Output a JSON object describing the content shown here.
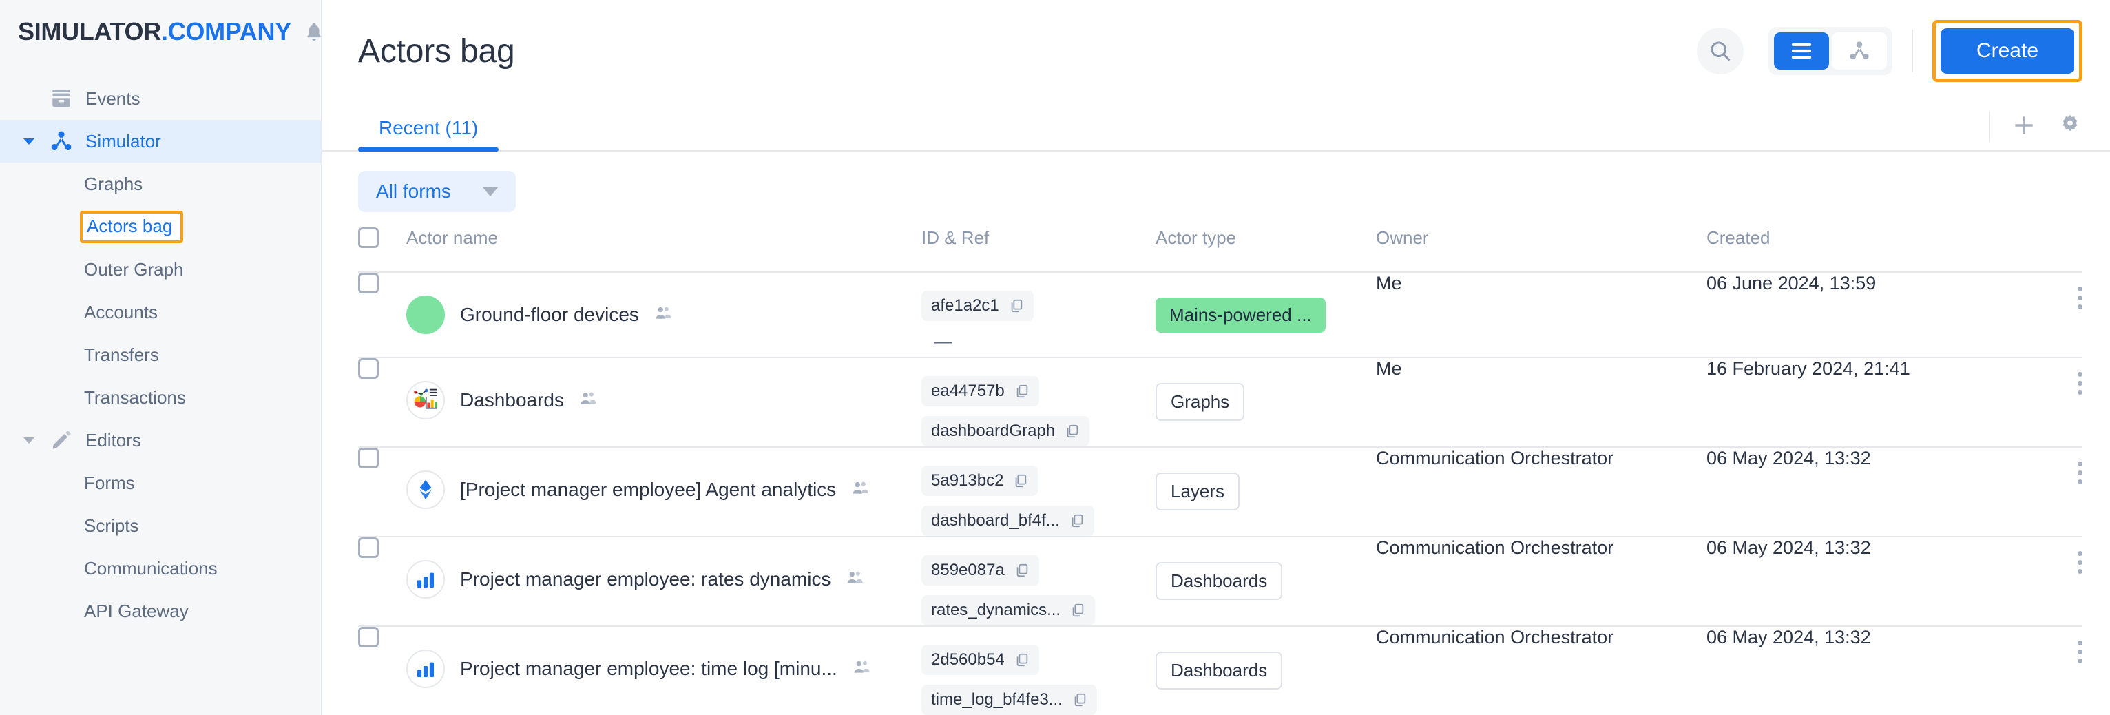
{
  "brand": {
    "name_dark": "SIMULATOR",
    "name_blue": ".COMPANY",
    "bell_icon": "bell-icon"
  },
  "sidebar": {
    "items": [
      {
        "label": "Events",
        "icon": "archive-icon",
        "type": "group",
        "expandable": false,
        "active": false
      },
      {
        "label": "Simulator",
        "icon": "graph-node-icon",
        "type": "group",
        "expandable": true,
        "active": true
      },
      {
        "label": "Graphs",
        "type": "sub",
        "active": false
      },
      {
        "label": "Actors bag",
        "type": "sub",
        "active": true,
        "highlighted": true
      },
      {
        "label": "Outer Graph",
        "type": "sub",
        "active": false
      },
      {
        "label": "Accounts",
        "type": "sub",
        "active": false
      },
      {
        "label": "Transfers",
        "type": "sub",
        "active": false
      },
      {
        "label": "Transactions",
        "type": "sub",
        "active": false
      },
      {
        "label": "Editors",
        "icon": "pencil-icon",
        "type": "group",
        "expandable": true,
        "active": false
      },
      {
        "label": "Forms",
        "type": "sub",
        "active": false
      },
      {
        "label": "Scripts",
        "type": "sub",
        "active": false
      },
      {
        "label": "Communications",
        "type": "sub",
        "active": false
      },
      {
        "label": "API Gateway",
        "type": "sub",
        "active": false
      }
    ]
  },
  "header": {
    "title": "Actors bag",
    "search_icon": "search-icon",
    "view_list_icon": "list-view-icon",
    "view_graph_icon": "graph-view-icon",
    "create_label": "Create"
  },
  "tabs": {
    "items": [
      {
        "label": "Recent (11)",
        "active": true
      }
    ],
    "add_icon": "plus-icon",
    "settings_icon": "gear-icon"
  },
  "filter": {
    "label": "All forms",
    "caret_icon": "chevron-down-icon"
  },
  "table": {
    "columns": [
      "Actor name",
      "ID & Ref",
      "Actor type",
      "Owner",
      "Created"
    ],
    "rows": [
      {
        "name": "Ground-floor devices",
        "avatar": "green-circle-icon",
        "shared_icon": "people-icon",
        "ids": [
          "afe1a2c1"
        ],
        "ref_dash": "—",
        "type": "Mains-powered ...",
        "type_style": "green",
        "owner": "Me",
        "created": "06 June 2024, 13:59",
        "menu_icon": "kebab-menu-icon"
      },
      {
        "name": "Dashboards",
        "avatar": "analytics-chart-icon",
        "shared_icon": "people-icon",
        "ids": [
          "ea44757b",
          "dashboardGraph"
        ],
        "ref_dash": "",
        "type": "Graphs",
        "type_style": "plain",
        "owner": "Me",
        "created": "16 February 2024, 21:41",
        "menu_icon": "kebab-menu-icon"
      },
      {
        "name": "[Project manager employee] Agent analytics",
        "avatar": "blue-diamond-icon",
        "shared_icon": "people-icon",
        "ids": [
          "5a913bc2",
          "dashboard_bf4f..."
        ],
        "ref_dash": "",
        "type": "Layers",
        "type_style": "plain",
        "owner": "Communication Orchestrator",
        "created": "06 May 2024, 13:32",
        "menu_icon": "kebab-menu-icon"
      },
      {
        "name": "Project manager employee: rates dynamics",
        "avatar": "bar-chart-icon",
        "shared_icon": "people-icon",
        "ids": [
          "859e087a",
          "rates_dynamics..."
        ],
        "ref_dash": "",
        "type": "Dashboards",
        "type_style": "plain",
        "owner": "Communication Orchestrator",
        "created": "06 May 2024, 13:32",
        "menu_icon": "kebab-menu-icon"
      },
      {
        "name": "Project manager employee: time log [minu...",
        "avatar": "bar-chart-icon",
        "shared_icon": "people-icon",
        "ids": [
          "2d560b54",
          "time_log_bf4fe3..."
        ],
        "ref_dash": "",
        "type": "Dashboards",
        "type_style": "plain",
        "owner": "Communication Orchestrator",
        "created": "06 May 2024, 13:32",
        "menu_icon": "kebab-menu-icon"
      }
    ]
  },
  "colors": {
    "accent_blue": "#1a73e8",
    "highlight_orange": "#f5a11a",
    "tag_green": "#7de2a0",
    "sidebar_bg": "#f6f7f9",
    "text_dark": "#2b3445",
    "text_muted": "#8b97ab"
  }
}
